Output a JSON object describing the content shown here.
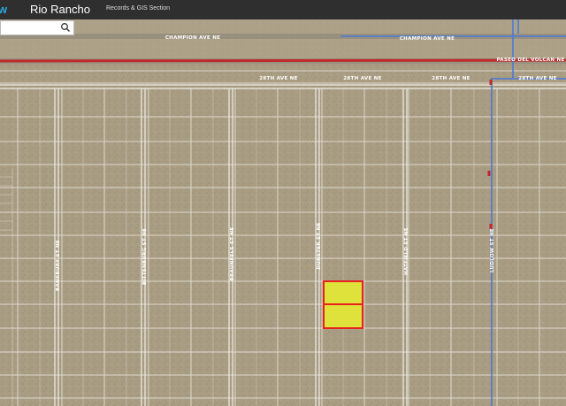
{
  "header": {
    "brand_glyph": "w",
    "title": "Rio Rancho",
    "section": "Records & GIS Section"
  },
  "search": {
    "value": "",
    "icon": "search-icon"
  },
  "map": {
    "roads": {
      "champion_west": "CHAMPION AVE NE",
      "champion_east": "CHAMPION AVE NE",
      "paseo": "PASEO DEL VOLCAN NE",
      "ave28_a": "28TH AVE NE",
      "ave28_b": "28TH AVE NE",
      "ave28_c": "28TH AVE NE",
      "ave28_d": "28TH AVE NE",
      "bankbury": "BANKBURY ST NE",
      "bittenburg": "BITTENBURG ST NE",
      "braunfels": "BRAUNFELS ST NE",
      "dunster": "DUNSTER ST NE",
      "hatfield": "HATFIELD ST NE",
      "ludlow": "LUDLOW ST NE"
    },
    "colors": {
      "ground": "#a89c82",
      "parcel_line": "#e8e4dc",
      "major_road": "#c0282a",
      "utility": "#4a7ad8",
      "selected_fill": "#dfe23a",
      "selected_stroke": "#e8201e"
    }
  }
}
